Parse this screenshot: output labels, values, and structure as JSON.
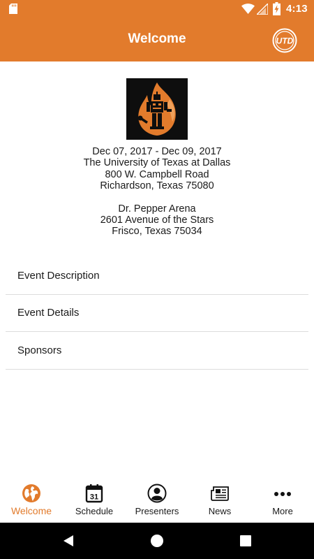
{
  "status_bar": {
    "time": "4:13",
    "icons": [
      "sd-card-icon",
      "wifi-icon",
      "cell-signal-icon",
      "battery-charging-icon"
    ]
  },
  "app_bar": {
    "title": "Welcome",
    "logo_icon": "utd-logo-icon",
    "logo_text": "UTD"
  },
  "event": {
    "logo_icon": "event-flame-robot-logo",
    "dates": "Dec 07, 2017 - Dec 09, 2017",
    "venue1": {
      "line1": "The University of Texas at Dallas",
      "line2": "800 W. Campbell Road",
      "line3": "Richardson, Texas 75080"
    },
    "venue2": {
      "line1": "Dr. Pepper Arena",
      "line2": "2601 Avenue of the Stars",
      "line3": "Frisco, Texas 75034"
    }
  },
  "menu": {
    "items": [
      {
        "label": "Event Description"
      },
      {
        "label": "Event Details"
      },
      {
        "label": "Sponsors"
      }
    ]
  },
  "bottom_nav": {
    "tabs": [
      {
        "label": "Welcome",
        "icon": "globe-icon",
        "active": true
      },
      {
        "label": "Schedule",
        "icon": "calendar-icon",
        "calendar_day": "31",
        "active": false
      },
      {
        "label": "Presenters",
        "icon": "person-icon",
        "active": false
      },
      {
        "label": "News",
        "icon": "newspaper-icon",
        "active": false
      },
      {
        "label": "More",
        "icon": "more-dots-icon",
        "active": false
      }
    ]
  },
  "colors": {
    "accent": "#e27b2c",
    "text": "#1a1a1a",
    "divider": "#dcdcdc",
    "system_nav": "#000000"
  }
}
